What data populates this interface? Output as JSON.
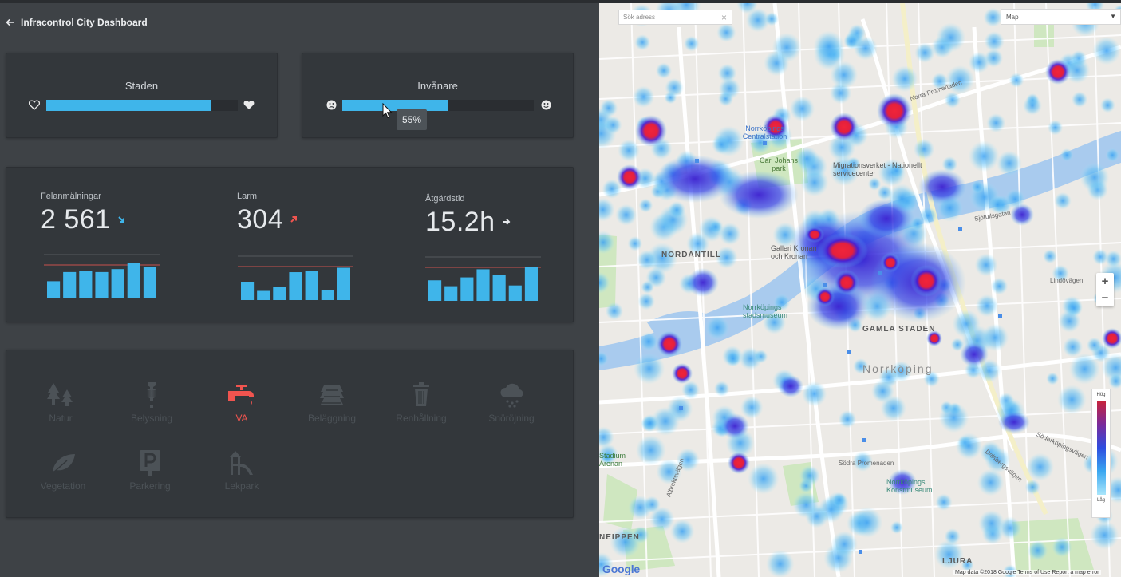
{
  "header": {
    "back_icon": "arrow-left-icon",
    "title": "Infracontrol City Dashboard"
  },
  "staden": {
    "title": "Staden",
    "value": 0.86,
    "left_icon": "heart-outline-icon",
    "right_icon": "heart-filled-icon"
  },
  "invanare": {
    "title": "Invånare",
    "value": 0.55,
    "tooltip": "55%",
    "left_icon": "sad-face-icon",
    "right_icon": "happy-face-icon"
  },
  "stats": [
    {
      "label": "Felanmälningar",
      "value": "2 561",
      "trend": "down",
      "trend_icon": "arrow-down-right-icon",
      "trend_color": "#3fb5ea",
      "bars": [
        0.47,
        0.72,
        0.76,
        0.72,
        0.8,
        0.96,
        0.86
      ]
    },
    {
      "label": "Larm",
      "value": "304",
      "trend": "up",
      "trend_icon": "arrow-up-right-icon",
      "trend_color": "#f0544f",
      "bars": [
        0.5,
        0.25,
        0.35,
        0.76,
        0.8,
        0.28,
        0.88
      ]
    },
    {
      "label": "Åtgärdstid",
      "value": "15.2h",
      "trend": "flat",
      "trend_icon": "arrow-right-icon",
      "trend_color": "#e6e9ec",
      "bars": [
        0.56,
        0.4,
        0.64,
        0.86,
        0.7,
        0.42,
        0.92
      ]
    }
  ],
  "categories": [
    {
      "label": "Natur",
      "icon": "trees-icon",
      "active": false
    },
    {
      "label": "Belysning",
      "icon": "lightbulb-icon",
      "active": false
    },
    {
      "label": "VA",
      "icon": "water-tap-icon",
      "active": true
    },
    {
      "label": "Beläggning",
      "icon": "road-paving-icon",
      "active": false
    },
    {
      "label": "Renhållning",
      "icon": "trash-can-icon",
      "active": false
    },
    {
      "label": "Snöröjning",
      "icon": "snow-cloud-icon",
      "active": false
    },
    {
      "label": "Vegetation",
      "icon": "leaf-icon",
      "active": false
    },
    {
      "label": "Parkering",
      "icon": "parking-icon",
      "active": false
    },
    {
      "label": "Lekpark",
      "icon": "playground-icon",
      "active": false
    }
  ],
  "map": {
    "search_placeholder": "Sök adress",
    "map_type": "Map",
    "zoom_in": "+",
    "zoom_out": "−",
    "legend_high": "Hög",
    "legend_low": "Låg",
    "footer": "Map data ©2018 Google   Terms of Use   Report a map error",
    "google": "Google",
    "labels": {
      "nordantill": "NORDANTILL",
      "gamla_staden": "GAMLA STADEN",
      "norrkoping": "Norrköping",
      "carl_johans": "Carl Johans park",
      "migrationsverket": "Migrationsverket - Nationellt servicecenter",
      "norrkopings_central": "Norrköpings Centralstation",
      "galleri": "Galleri Kronan och Kronan",
      "stadsmuseum": "Norrköpings stadsmuseum",
      "konstmuseum": "Norrköpings Konstmuseum",
      "neippen": "NEIPPEN",
      "ljura": "LJURA",
      "stadium": "Stadium Arenan",
      "norra_promenaden": "Norra Promenaden",
      "sodra_promenaden": "Södra Promenaden",
      "sjotullsgatan": "Sjötullsgatan",
      "lindovagen": "Lindövägen",
      "soderkopingsvagen": "Söderköpingsvägen",
      "albrektsvagen": "Albrektsvägen",
      "dalsbergsvagen": "Dalsbergsvägen"
    }
  }
}
